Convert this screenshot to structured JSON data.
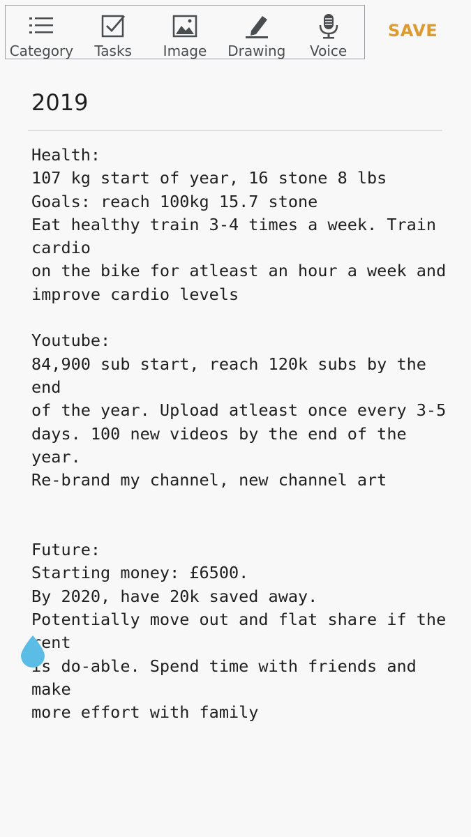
{
  "toolbar": {
    "items": [
      {
        "label": "Category",
        "icon": "list-icon"
      },
      {
        "label": "Tasks",
        "icon": "checkbox-icon"
      },
      {
        "label": "Image",
        "icon": "image-icon"
      },
      {
        "label": "Drawing",
        "icon": "pencil-icon"
      },
      {
        "label": "Voice",
        "icon": "microphone-icon"
      }
    ],
    "save_label": "SAVE"
  },
  "note": {
    "title": "2019",
    "body": "Health:\n107 kg start of year, 16 stone 8 lbs\nGoals: reach 100kg 15.7 stone\nEat healthy train 3-4 times a week. Train cardio\non the bike for atleast an hour a week and\nimprove cardio levels\n\nYoutube:\n84,900 sub start, reach 120k subs by the end\nof the year. Upload atleast once every 3-5\ndays. 100 new videos by the end of the year.\nRe-brand my channel, new channel art\n\n\nFuture:\nStarting money: £6500.\nBy 2020, have 20k saved away.\nPotentially move out and flat share if the rent\nis do-able. Spend time with friends and make\nmore effort with family"
  },
  "colors": {
    "save": "#dd9a2f",
    "cursor_handle": "#5bbde6",
    "icon": "#4a4d50"
  },
  "cursor_handle": {
    "icon": "text-cursor-drop-icon"
  }
}
